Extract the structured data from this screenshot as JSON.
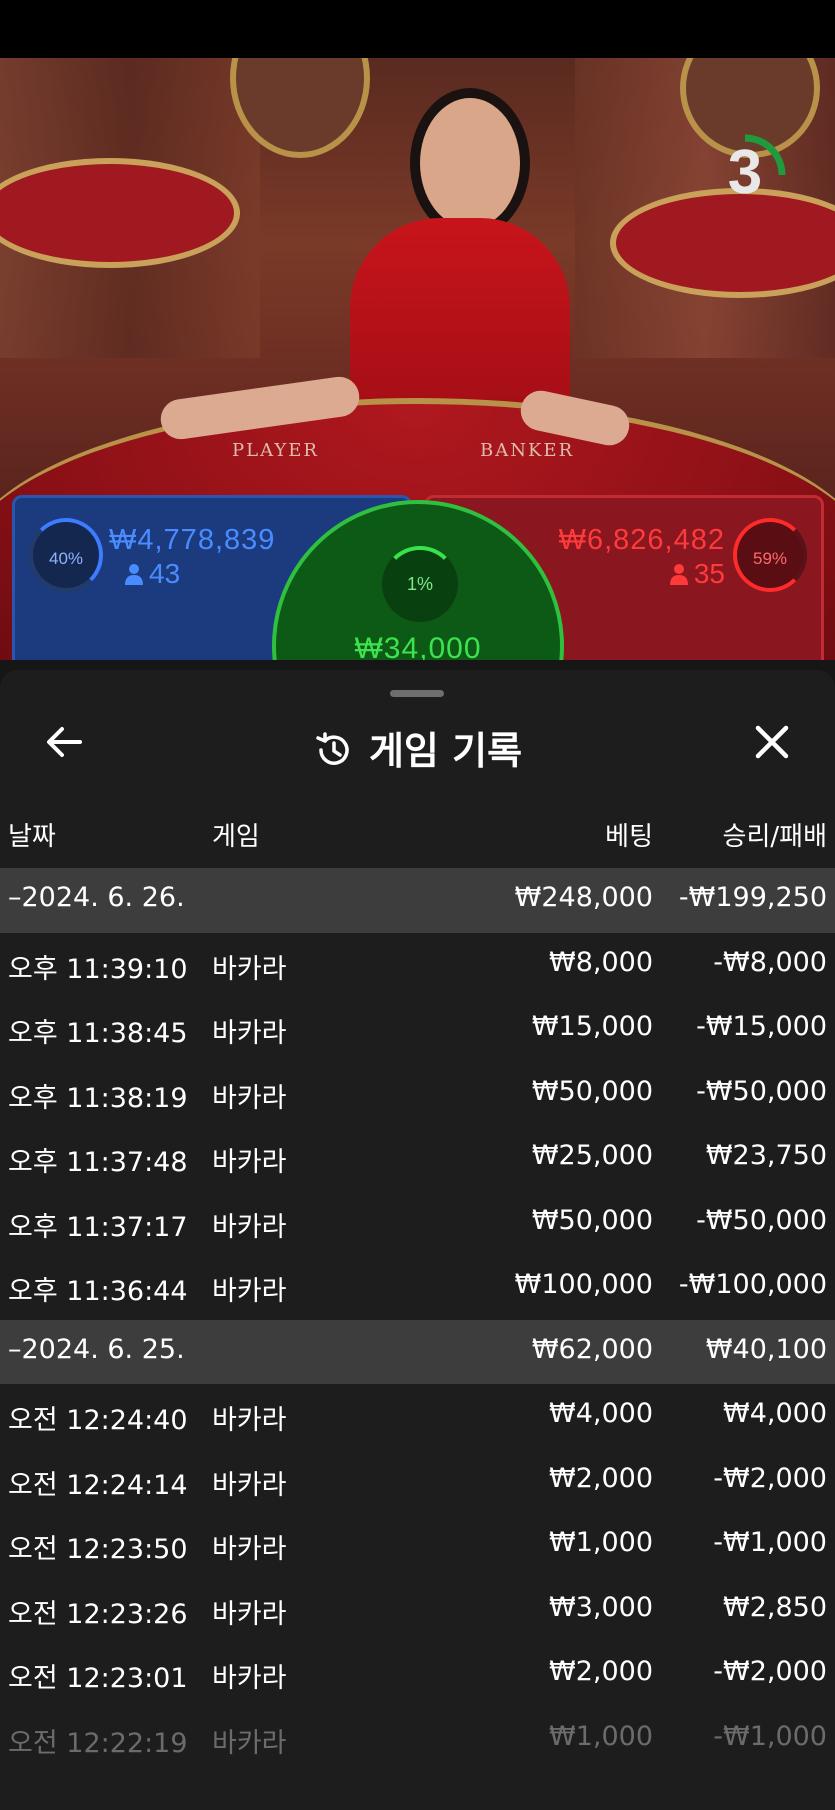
{
  "countdown": "3",
  "table_labels": {
    "player": "PLAYER",
    "banker": "BANKER"
  },
  "bets": {
    "player": {
      "percent": "40%",
      "amount": "₩4,778,839",
      "count": "43",
      "color": "#4a8bff"
    },
    "banker": {
      "percent": "59%",
      "amount": "₩6,826,482",
      "count": "35",
      "color": "#ff3a3a"
    },
    "tie": {
      "percent": "1%",
      "amount": "₩34,000",
      "color": "#3ee24f"
    }
  },
  "sheet": {
    "title": "게임 기록",
    "title_icon": "history-icon",
    "back_icon": "arrow-left-icon",
    "close_icon": "close-icon",
    "columns": {
      "date": "날짜",
      "game": "게임",
      "bet": "베팅",
      "result": "승리/패배"
    },
    "rows": [
      {
        "type": "date",
        "time": "–2024. 6. 26.",
        "game": "",
        "bet": "₩248,000",
        "result": "-₩199,250"
      },
      {
        "type": "item",
        "time": "오후 11:39:10",
        "game": "바카라",
        "bet": "₩8,000",
        "result": "-₩8,000"
      },
      {
        "type": "item",
        "time": "오후 11:38:45",
        "game": "바카라",
        "bet": "₩15,000",
        "result": "-₩15,000"
      },
      {
        "type": "item",
        "time": "오후 11:38:19",
        "game": "바카라",
        "bet": "₩50,000",
        "result": "-₩50,000"
      },
      {
        "type": "item",
        "time": "오후 11:37:48",
        "game": "바카라",
        "bet": "₩25,000",
        "result": "₩23,750"
      },
      {
        "type": "item",
        "time": "오후 11:37:17",
        "game": "바카라",
        "bet": "₩50,000",
        "result": "-₩50,000"
      },
      {
        "type": "item",
        "time": "오후 11:36:44",
        "game": "바카라",
        "bet": "₩100,000",
        "result": "-₩100,000"
      },
      {
        "type": "date",
        "time": "–2024. 6. 25.",
        "game": "",
        "bet": "₩62,000",
        "result": "₩40,100"
      },
      {
        "type": "item",
        "time": "오전 12:24:40",
        "game": "바카라",
        "bet": "₩4,000",
        "result": "₩4,000"
      },
      {
        "type": "item",
        "time": "오전 12:24:14",
        "game": "바카라",
        "bet": "₩2,000",
        "result": "-₩2,000"
      },
      {
        "type": "item",
        "time": "오전 12:23:50",
        "game": "바카라",
        "bet": "₩1,000",
        "result": "-₩1,000"
      },
      {
        "type": "item",
        "time": "오전 12:23:26",
        "game": "바카라",
        "bet": "₩3,000",
        "result": "₩2,850"
      },
      {
        "type": "item",
        "time": "오전 12:23:01",
        "game": "바카라",
        "bet": "₩2,000",
        "result": "-₩2,000"
      },
      {
        "type": "item",
        "time": "오전 12:22:19",
        "game": "바카라",
        "bet": "₩1,000",
        "result": "-₩1,000"
      }
    ]
  }
}
